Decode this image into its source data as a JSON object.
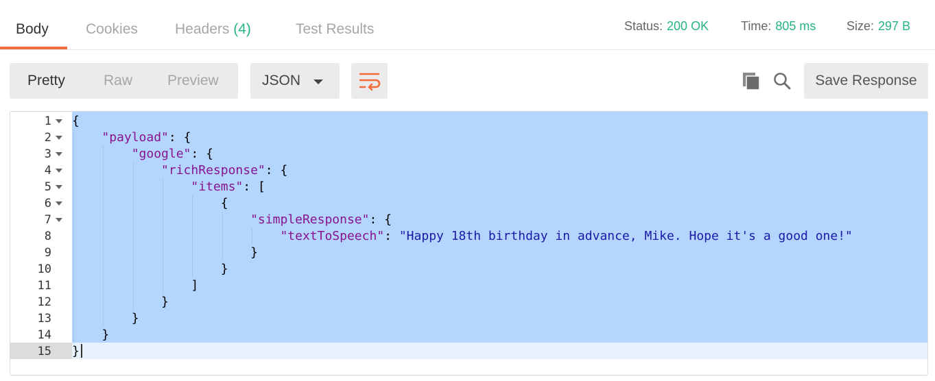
{
  "tabs": {
    "body": "Body",
    "cookies": "Cookies",
    "headers": "Headers",
    "headers_count": "(4)",
    "tests": "Test Results"
  },
  "meta": {
    "status_label": "Status:",
    "status_value": "200 OK",
    "time_label": "Time:",
    "time_value": "805 ms",
    "size_label": "Size:",
    "size_value": "297 B"
  },
  "view_modes": {
    "pretty": "Pretty",
    "raw": "Raw",
    "preview": "Preview",
    "active": "Pretty"
  },
  "format_select": {
    "value": "JSON"
  },
  "actions": {
    "wrap_icon": "wrap-lines-icon",
    "copy_icon": "copy-icon",
    "search_icon": "search-icon",
    "save_label": "Save Response"
  },
  "colors": {
    "accent": "#f26b3a",
    "success": "#26b47f",
    "selection": "#b4d5fe",
    "json_key": "#881391",
    "json_string": "#1a1aa6"
  },
  "editor": {
    "lines": [
      {
        "n": "1",
        "fold": true,
        "indent": 0,
        "tokens": [
          {
            "t": "{",
            "c": "p"
          }
        ]
      },
      {
        "n": "2",
        "fold": true,
        "indent": 1,
        "tokens": [
          {
            "t": "\"payload\"",
            "c": "key"
          },
          {
            "t": ": {",
            "c": "p"
          }
        ]
      },
      {
        "n": "3",
        "fold": true,
        "indent": 2,
        "tokens": [
          {
            "t": "\"google\"",
            "c": "key"
          },
          {
            "t": ": {",
            "c": "p"
          }
        ]
      },
      {
        "n": "4",
        "fold": true,
        "indent": 3,
        "tokens": [
          {
            "t": "\"richResponse\"",
            "c": "key"
          },
          {
            "t": ": {",
            "c": "p"
          }
        ]
      },
      {
        "n": "5",
        "fold": true,
        "indent": 4,
        "tokens": [
          {
            "t": "\"items\"",
            "c": "key"
          },
          {
            "t": ": [",
            "c": "p"
          }
        ]
      },
      {
        "n": "6",
        "fold": true,
        "indent": 5,
        "tokens": [
          {
            "t": "{",
            "c": "p"
          }
        ]
      },
      {
        "n": "7",
        "fold": true,
        "indent": 6,
        "tokens": [
          {
            "t": "\"simpleResponse\"",
            "c": "key"
          },
          {
            "t": ": {",
            "c": "p"
          }
        ]
      },
      {
        "n": "8",
        "fold": false,
        "indent": 7,
        "tokens": [
          {
            "t": "\"textToSpeech\"",
            "c": "key"
          },
          {
            "t": ": ",
            "c": "p"
          },
          {
            "t": "\"Happy 18th birthday in advance, Mike. Hope it's a good one!\"",
            "c": "str"
          }
        ]
      },
      {
        "n": "9",
        "fold": false,
        "indent": 6,
        "tokens": [
          {
            "t": "}",
            "c": "p"
          }
        ]
      },
      {
        "n": "10",
        "fold": false,
        "indent": 5,
        "tokens": [
          {
            "t": "}",
            "c": "p"
          }
        ]
      },
      {
        "n": "11",
        "fold": false,
        "indent": 4,
        "tokens": [
          {
            "t": "]",
            "c": "p"
          }
        ]
      },
      {
        "n": "12",
        "fold": false,
        "indent": 3,
        "tokens": [
          {
            "t": "}",
            "c": "p"
          }
        ]
      },
      {
        "n": "13",
        "fold": false,
        "indent": 2,
        "tokens": [
          {
            "t": "}",
            "c": "p"
          }
        ]
      },
      {
        "n": "14",
        "fold": false,
        "indent": 1,
        "tokens": [
          {
            "t": "}",
            "c": "p"
          }
        ]
      },
      {
        "n": "15",
        "fold": false,
        "indent": 0,
        "tokens": [
          {
            "t": "}",
            "c": "p"
          }
        ]
      }
    ]
  }
}
